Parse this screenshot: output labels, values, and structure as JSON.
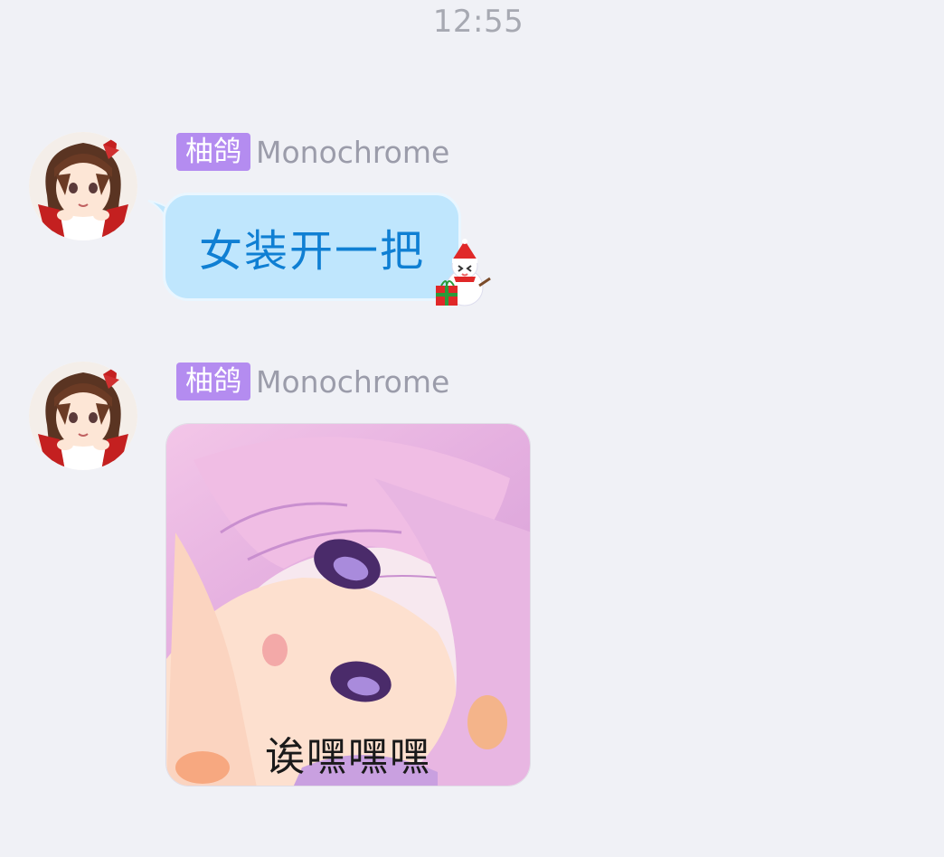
{
  "status": {
    "time": "12:55"
  },
  "messages": [
    {
      "sender": {
        "tag": "柚鸽",
        "name": "Monochrome",
        "avatar_icon": "anime-girl-avatar-icon"
      },
      "type": "text",
      "text": "女装开一把",
      "decoration_icon": "snowman-gift-icon"
    },
    {
      "sender": {
        "tag": "柚鸽",
        "name": "Monochrome",
        "avatar_icon": "anime-girl-avatar-icon"
      },
      "type": "sticker",
      "caption": "诶嘿嘿嘿",
      "sticker_icon": "pink-hair-anime-sticker"
    }
  ],
  "colors": {
    "background": "#f0f1f6",
    "tag_bg": "#b48cf0",
    "bubble_bg": "#bfe6fd",
    "bubble_text": "#0f7fd3",
    "name_text": "#9b9caa",
    "time_text": "#a7a9b2"
  }
}
